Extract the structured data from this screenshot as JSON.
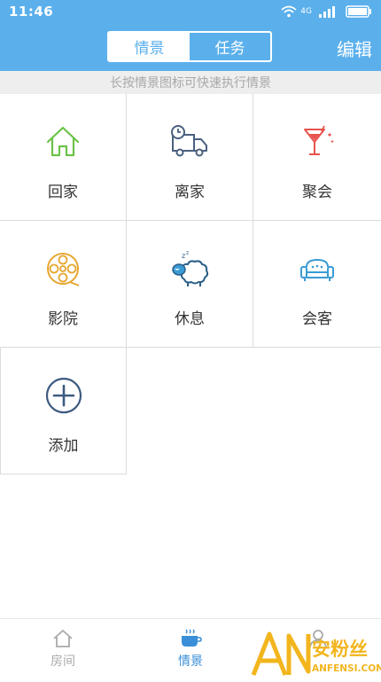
{
  "status_bar": {
    "time": "11:46",
    "network": "4G"
  },
  "header": {
    "tabs": [
      {
        "label": "情景",
        "active": true
      },
      {
        "label": "任务",
        "active": false
      }
    ],
    "edit_label": "编辑"
  },
  "hint": "长按情景图标可快速执行情景",
  "scenes": [
    {
      "label": "回家",
      "icon": "home-icon"
    },
    {
      "label": "离家",
      "icon": "truck-clock-icon"
    },
    {
      "label": "聚会",
      "icon": "cocktail-icon"
    },
    {
      "label": "影院",
      "icon": "film-reel-icon"
    },
    {
      "label": "休息",
      "icon": "sleeping-sheep-icon"
    },
    {
      "label": "会客",
      "icon": "sofa-icon"
    },
    {
      "label": "添加",
      "icon": "add-circle-icon"
    }
  ],
  "bottom_nav": [
    {
      "label": "房间",
      "icon": "house-icon",
      "active": false
    },
    {
      "label": "情景",
      "icon": "coffee-cup-icon",
      "active": true
    },
    {
      "label": "",
      "icon": "user-icon",
      "active": false
    }
  ],
  "watermark": {
    "brand": "安粉丝",
    "domain": "ANFENSI.COM",
    "logo_letters": "AN"
  },
  "colors": {
    "primary": "#5bb0ec",
    "nav_active": "#3a8fd8",
    "watermark_yellow": "#f2b51d"
  }
}
